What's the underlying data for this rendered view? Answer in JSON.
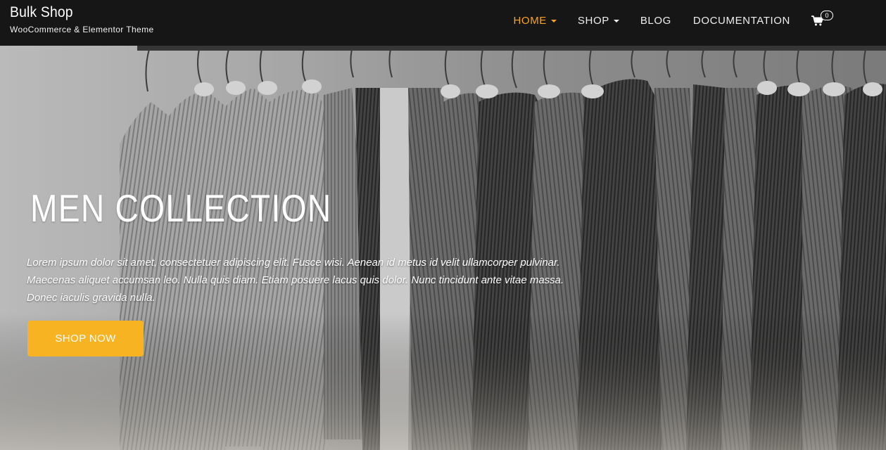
{
  "header": {
    "site_title": "Bulk Shop",
    "tagline": "WooCommerce & Elementor Theme",
    "background": "#161616"
  },
  "nav": {
    "items": [
      {
        "label": "HOME",
        "active": true,
        "dropdown": true
      },
      {
        "label": "SHOP",
        "active": false,
        "dropdown": true
      },
      {
        "label": "BLOG",
        "active": false,
        "dropdown": false
      },
      {
        "label": "DOCUMENTATION",
        "active": false,
        "dropdown": false
      }
    ],
    "active_color": "#f6a623",
    "cart": {
      "icon": "shopping-cart-icon",
      "count": "0"
    }
  },
  "hero": {
    "image": "clothes-rack-photo",
    "title": "MEN COLLECTION",
    "text": "Lorem ipsum dolor sit amet, consectetuer adipiscing elit. Fusce wisi. Aenean id metus id velit ullamcorper pulvinar. Maecenas aliquet accumsan leo. Nulla quis diam. Etiam posuere lacus quis dolor. Nunc tincidunt ante vitae massa. Donec iaculis gravida nulla.",
    "button_label": "SHOP NOW",
    "button_color": "#f7b322"
  }
}
